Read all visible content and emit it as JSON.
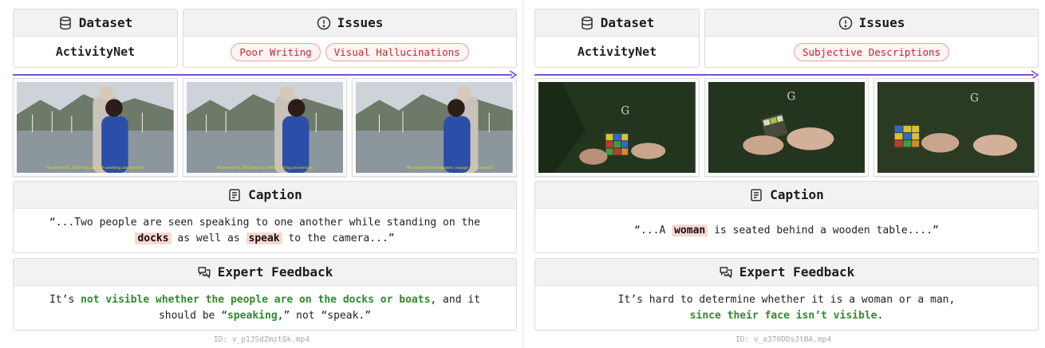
{
  "left": {
    "dataset_header": "Dataset",
    "dataset_name": "ActivityNet",
    "issues_header": "Issues",
    "issues": [
      "Poor Writing",
      "Visual Hallucinations"
    ],
    "frame_subtitles": [
      "November 8, 2012 was our fifth wedding anniversary",
      "November 8, 2012 was our fifth wedding anniversary",
      "We started a transoceanic voyage and named it"
    ],
    "caption_header": "Caption",
    "caption": {
      "p1": "“...Two people are seen speaking to one another while standing on the",
      "h1": "docks",
      "p2": " as well as ",
      "h2": "speak",
      "p3": " to the camera...”"
    },
    "feedback_header": "Expert Feedback",
    "feedback": {
      "p1": "It’s ",
      "g1": "not visible whether the people are on the docks or boats",
      "p2": ", and it should be “",
      "g2": "speaking",
      "p3": ",” not “speak.”"
    },
    "video_id": "ID: v_p1JSdZmztGk.mp4"
  },
  "right": {
    "dataset_header": "Dataset",
    "dataset_name": "ActivityNet",
    "issues_header": "Issues",
    "issues": [
      "Subjective Descriptions"
    ],
    "caption_header": "Caption",
    "caption": {
      "p1": "“...A ",
      "h1": "woman",
      "p2": " is seated behind a wooden table....”"
    },
    "feedback_header": "Expert Feedback",
    "feedback": {
      "p1": "It’s hard to determine whether it is a woman or a man,",
      "g1": "since their face isn’t visible",
      "p2": "."
    },
    "video_id": "ID: v_a370DDsJtBA.mp4"
  },
  "colors": {
    "accent_arrow": "#7c4dde",
    "tag_border": "#e9a0a0",
    "tag_text": "#c62828",
    "highlight_red": "#fbd7d2",
    "highlight_green": "#2e8b2e"
  },
  "icons": {
    "dataset": "database-icon",
    "issues": "exclamation-circle-icon",
    "caption": "document-text-icon",
    "feedback": "chat-bubbles-icon"
  }
}
